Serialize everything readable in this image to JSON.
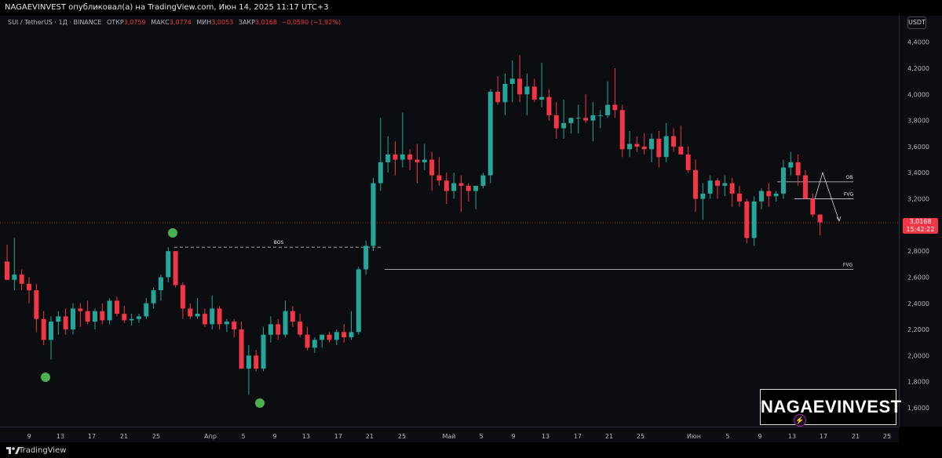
{
  "header": {
    "published_line": "NAGAEVINVEST опубликовал(а) на TradingView.com, Июн 14, 2025 11:17 UTC+3"
  },
  "legend": {
    "symbol": "SUI / TetherUS · 1Д · BINANCE",
    "open_label": "ОТКР",
    "open_value": "3,0759",
    "high_label": "МАКС",
    "high_value": "3,0774",
    "low_label": "МИН",
    "low_value": "3,0053",
    "close_label": "ЗАКР",
    "close_value": "3,0168",
    "change": "−0,0590 (−1,92%)"
  },
  "price_axis": {
    "currency": "USDT",
    "last_price": "3,0168",
    "countdown": "15:42:22"
  },
  "watermark": "NAGAEVINVEST",
  "footer": {
    "brand": "TradingView"
  },
  "colors": {
    "up": "#26a69a",
    "down": "#f23645",
    "marker": "#4caf50",
    "line": "#d1d4dc"
  },
  "chart_data": {
    "type": "candlestick",
    "ylim": [
      1.5,
      4.5
    ],
    "y_ticks": [
      "1,6000",
      "1,8000",
      "2,0000",
      "2,2000",
      "2,4000",
      "2,6000",
      "2,8000",
      "3,0000",
      "3,2000",
      "3,4000",
      "3,6000",
      "3,8000",
      "4,0000",
      "4,2000",
      "4,4000"
    ],
    "x_ticks": [
      "9",
      "13",
      "17",
      "21",
      "25",
      "Апр",
      "5",
      "9",
      "13",
      "17",
      "21",
      "25",
      "Май",
      "5",
      "9",
      "13",
      "17",
      "21",
      "25",
      "Июн",
      "5",
      "9",
      "13",
      "17",
      "21",
      "25"
    ],
    "candles": [
      [
        2.72,
        2.85,
        2.58,
        2.58
      ],
      [
        2.58,
        2.9,
        2.5,
        2.62
      ],
      [
        2.62,
        2.66,
        2.5,
        2.55
      ],
      [
        2.55,
        2.6,
        2.4,
        2.5
      ],
      [
        2.5,
        2.55,
        2.18,
        2.28
      ],
      [
        2.28,
        2.34,
        2.08,
        2.12
      ],
      [
        2.12,
        2.3,
        1.97,
        2.26
      ],
      [
        2.26,
        2.34,
        2.16,
        2.3
      ],
      [
        2.3,
        2.36,
        2.16,
        2.2
      ],
      [
        2.2,
        2.4,
        2.16,
        2.36
      ],
      [
        2.36,
        2.4,
        2.22,
        2.34
      ],
      [
        2.34,
        2.42,
        2.24,
        2.26
      ],
      [
        2.26,
        2.36,
        2.2,
        2.34
      ],
      [
        2.34,
        2.4,
        2.24,
        2.27
      ],
      [
        2.27,
        2.44,
        2.24,
        2.42
      ],
      [
        2.42,
        2.45,
        2.3,
        2.32
      ],
      [
        2.32,
        2.38,
        2.25,
        2.27
      ],
      [
        2.27,
        2.32,
        2.23,
        2.28
      ],
      [
        2.28,
        2.32,
        2.25,
        2.3
      ],
      [
        2.3,
        2.44,
        2.28,
        2.4
      ],
      [
        2.4,
        2.52,
        2.36,
        2.5
      ],
      [
        2.5,
        2.62,
        2.42,
        2.6
      ],
      [
        2.6,
        2.83,
        2.56,
        2.8
      ],
      [
        2.8,
        2.8,
        2.52,
        2.54
      ],
      [
        2.54,
        2.56,
        2.28,
        2.36
      ],
      [
        2.36,
        2.4,
        2.28,
        2.3
      ],
      [
        2.3,
        2.44,
        2.28,
        2.32
      ],
      [
        2.32,
        2.36,
        2.22,
        2.24
      ],
      [
        2.24,
        2.46,
        2.2,
        2.36
      ],
      [
        2.36,
        2.38,
        2.2,
        2.24
      ],
      [
        2.24,
        2.28,
        2.18,
        2.26
      ],
      [
        2.26,
        2.28,
        2.14,
        2.2
      ],
      [
        2.2,
        2.26,
        1.98,
        1.9
      ],
      [
        1.9,
        2.08,
        1.7,
        2.0
      ],
      [
        2.0,
        2.04,
        1.88,
        1.9
      ],
      [
        1.9,
        2.22,
        1.88,
        2.16
      ],
      [
        2.16,
        2.3,
        2.1,
        2.24
      ],
      [
        2.24,
        2.28,
        2.12,
        2.16
      ],
      [
        2.16,
        2.42,
        2.14,
        2.34
      ],
      [
        2.34,
        2.38,
        2.22,
        2.26
      ],
      [
        2.26,
        2.32,
        2.14,
        2.16
      ],
      [
        2.16,
        2.22,
        2.04,
        2.06
      ],
      [
        2.06,
        2.14,
        2.02,
        2.12
      ],
      [
        2.12,
        2.16,
        2.06,
        2.16
      ],
      [
        2.16,
        2.18,
        2.1,
        2.12
      ],
      [
        2.12,
        2.2,
        2.08,
        2.18
      ],
      [
        2.18,
        2.24,
        2.1,
        2.14
      ],
      [
        2.14,
        2.34,
        2.12,
        2.18
      ],
      [
        2.18,
        2.68,
        2.16,
        2.66
      ],
      [
        2.66,
        2.88,
        2.62,
        2.84
      ],
      [
        2.84,
        3.36,
        2.8,
        3.32
      ],
      [
        3.32,
        3.82,
        3.26,
        3.48
      ],
      [
        3.48,
        3.68,
        3.4,
        3.54
      ],
      [
        3.54,
        3.64,
        3.38,
        3.5
      ],
      [
        3.5,
        3.86,
        3.44,
        3.54
      ],
      [
        3.54,
        3.58,
        3.42,
        3.5
      ],
      [
        3.5,
        3.62,
        3.32,
        3.48
      ],
      [
        3.48,
        3.62,
        3.42,
        3.5
      ],
      [
        3.5,
        3.56,
        3.26,
        3.38
      ],
      [
        3.38,
        3.52,
        3.3,
        3.34
      ],
      [
        3.34,
        3.4,
        3.16,
        3.26
      ],
      [
        3.26,
        3.4,
        3.2,
        3.32
      ],
      [
        3.32,
        3.38,
        3.1,
        3.3
      ],
      [
        3.3,
        3.32,
        3.18,
        3.26
      ],
      [
        3.26,
        3.3,
        3.12,
        3.3
      ],
      [
        3.3,
        3.4,
        3.28,
        3.38
      ],
      [
        3.38,
        4.04,
        3.32,
        4.02
      ],
      [
        4.02,
        4.14,
        3.92,
        3.94
      ],
      [
        3.94,
        4.16,
        3.84,
        4.08
      ],
      [
        4.08,
        4.26,
        3.94,
        4.12
      ],
      [
        4.12,
        4.3,
        3.94,
        4.0
      ],
      [
        4.0,
        4.16,
        3.84,
        4.06
      ],
      [
        4.06,
        4.12,
        3.94,
        3.96
      ],
      [
        3.96,
        4.24,
        3.9,
        3.98
      ],
      [
        3.98,
        4.04,
        3.8,
        3.84
      ],
      [
        3.84,
        3.94,
        3.66,
        3.74
      ],
      [
        3.74,
        3.96,
        3.66,
        3.78
      ],
      [
        3.78,
        3.82,
        3.7,
        3.82
      ],
      [
        3.82,
        3.92,
        3.7,
        3.82
      ],
      [
        3.82,
        4.0,
        3.78,
        3.8
      ],
      [
        3.8,
        3.94,
        3.64,
        3.84
      ],
      [
        3.84,
        3.88,
        3.74,
        3.84
      ],
      [
        3.84,
        4.1,
        3.82,
        3.92
      ],
      [
        3.92,
        4.2,
        3.82,
        3.88
      ],
      [
        3.88,
        3.92,
        3.52,
        3.58
      ],
      [
        3.58,
        3.72,
        3.52,
        3.62
      ],
      [
        3.62,
        3.68,
        3.56,
        3.6
      ],
      [
        3.6,
        3.7,
        3.54,
        3.58
      ],
      [
        3.58,
        3.7,
        3.48,
        3.66
      ],
      [
        3.66,
        3.72,
        3.44,
        3.52
      ],
      [
        3.52,
        3.78,
        3.48,
        3.68
      ],
      [
        3.68,
        3.74,
        3.56,
        3.6
      ],
      [
        3.6,
        3.76,
        3.56,
        3.54
      ],
      [
        3.54,
        3.6,
        3.4,
        3.42
      ],
      [
        3.42,
        3.5,
        3.1,
        3.2
      ],
      [
        3.2,
        3.32,
        3.04,
        3.24
      ],
      [
        3.24,
        3.38,
        3.2,
        3.34
      ],
      [
        3.34,
        3.36,
        3.2,
        3.3
      ],
      [
        3.3,
        3.38,
        3.22,
        3.32
      ],
      [
        3.32,
        3.36,
        3.14,
        3.24
      ],
      [
        3.24,
        3.3,
        3.14,
        3.18
      ],
      [
        3.18,
        3.2,
        2.86,
        2.9
      ],
      [
        2.9,
        3.22,
        2.84,
        3.18
      ],
      [
        3.18,
        3.28,
        3.12,
        3.26
      ],
      [
        3.26,
        3.32,
        3.14,
        3.22
      ],
      [
        3.22,
        3.26,
        3.18,
        3.24
      ],
      [
        3.24,
        3.5,
        3.2,
        3.44
      ],
      [
        3.44,
        3.56,
        3.38,
        3.48
      ],
      [
        3.48,
        3.54,
        3.3,
        3.38
      ],
      [
        3.38,
        3.42,
        3.2,
        3.2
      ],
      [
        3.2,
        3.24,
        3.06,
        3.08
      ],
      [
        3.08,
        3.08,
        2.92,
        3.02
      ]
    ],
    "annotations": [
      {
        "label": "BOS",
        "type": "dashed-line",
        "price": 2.83
      },
      {
        "label": "FVG",
        "type": "line",
        "price": 2.66
      },
      {
        "label": "OB",
        "type": "line",
        "price": 3.33
      },
      {
        "label": "FVG",
        "type": "line",
        "price": 3.2
      }
    ],
    "last_price": 3.0168
  }
}
